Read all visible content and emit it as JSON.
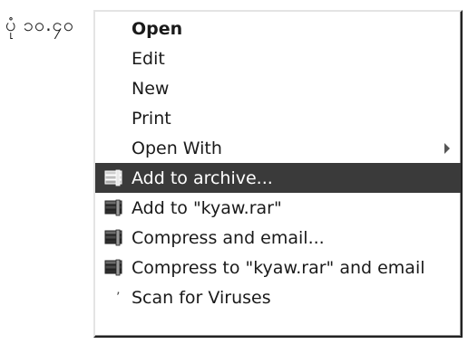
{
  "caption": "ပုံ ၁၀.၄၀",
  "menu": {
    "items": [
      {
        "label": "Open"
      },
      {
        "label": "Edit"
      },
      {
        "label": "New"
      },
      {
        "label": "Print"
      },
      {
        "label": "Open With"
      },
      {
        "label": "Add to archive...",
        "icon": "winrar-archive-icon"
      },
      {
        "label": "Add to \"kyaw.rar\"",
        "icon": "winrar-archive-icon"
      },
      {
        "label": "Compress and email...",
        "icon": "winrar-archive-icon"
      },
      {
        "label": "Compress to \"kyaw.rar\" and email",
        "icon": "winrar-archive-icon"
      },
      {
        "label": "Scan for Viruses",
        "icon": "scan-icon"
      }
    ]
  },
  "colors": {
    "highlight": "#3a3a3a",
    "highlight_text": "#ffffff",
    "text": "#1a1a1a"
  }
}
